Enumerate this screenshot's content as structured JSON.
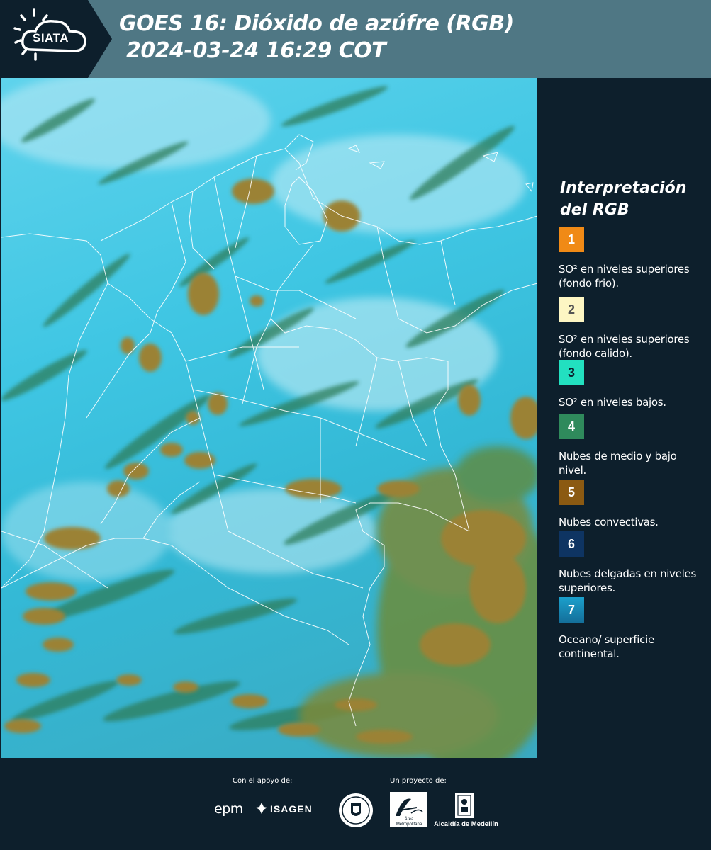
{
  "header": {
    "logo_text": "SIATA",
    "title_line1": "GOES 16: Dióxido de azúfre (RGB)",
    "title_line2": "2024-03-24 16:29 COT",
    "bar_color": "#4f7784",
    "logo_bg_color": "#0d1f2c"
  },
  "legend": {
    "title": "Interpretación del RGB",
    "items": [
      {
        "number": "1",
        "color": "#f08a16",
        "text_color": "#ffffff",
        "description": "SO² en niveles superiores (fondo frio)."
      },
      {
        "number": "2",
        "color": "#fdf6c3",
        "text_color": "#555555",
        "description": "SO² en niveles superiores (fondo calido)."
      },
      {
        "number": "3",
        "color": "#22e0c0",
        "text_color": "#0d1f2c",
        "description": "SO² en niveles bajos."
      },
      {
        "number": "4",
        "color": "#2f8a5c",
        "text_color": "#ffffff",
        "description": "Nubes de medio y bajo nivel."
      },
      {
        "number": "5",
        "color": "#8b5a12",
        "text_color": "#ffffff",
        "description": "Nubes convectivas."
      },
      {
        "number": "6",
        "color": "#0e3462",
        "text_color": "#ffffff",
        "description": "Nubes delgadas en niveles superiores."
      },
      {
        "number": "7",
        "color": "#1890bd",
        "text_color": "#ffffff",
        "description": "Oceano/ superficie continental."
      }
    ]
  },
  "footer": {
    "support_label": "Con el apoyo de:",
    "project_label": "Un proyecto de:",
    "sponsor_1": "epm",
    "sponsor_2": "ISAGEN",
    "partner_1_text": "Área Metropolitana Valle de Aburrá",
    "partner_2": "Alcaldía de Medellín"
  }
}
